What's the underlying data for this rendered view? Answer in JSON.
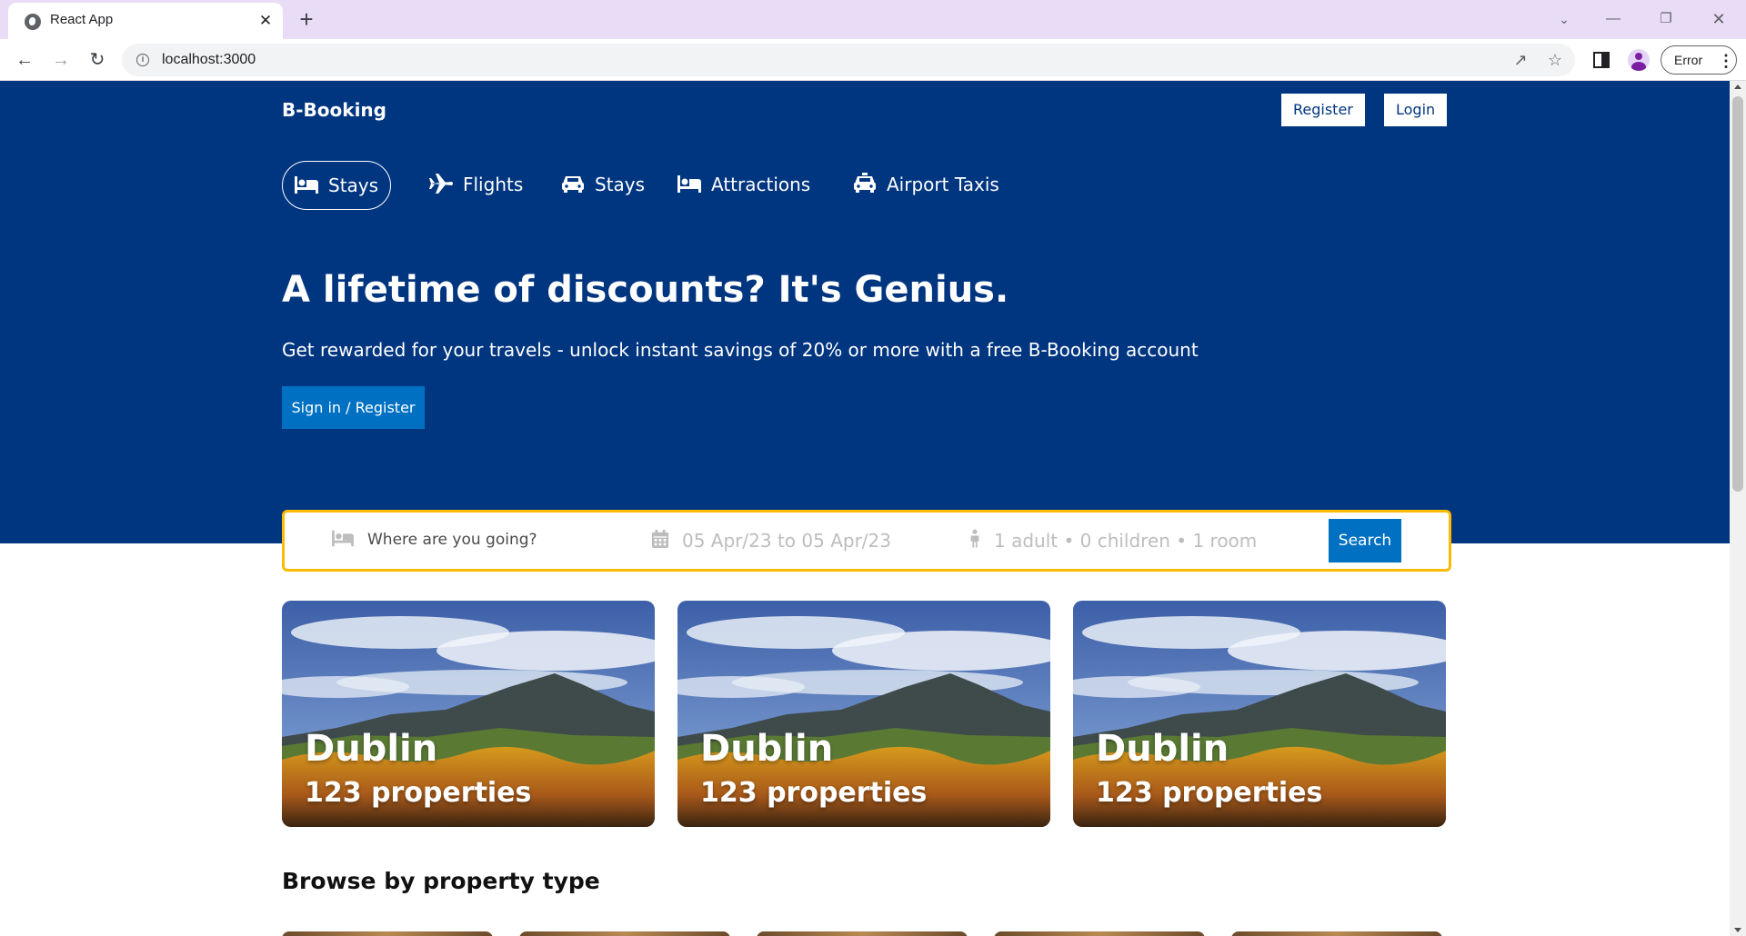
{
  "browser": {
    "tab_title": "React App",
    "tab_close": "✕",
    "new_tab": "+",
    "url": "localhost:3000",
    "profile_status": "Error"
  },
  "header": {
    "brand": "B-Booking",
    "register_label": "Register",
    "login_label": "Login"
  },
  "nav": {
    "items": [
      {
        "label": "Stays",
        "icon": "bed-icon",
        "active": true
      },
      {
        "label": "Flights",
        "icon": "plane-icon",
        "active": false
      },
      {
        "label": "Stays",
        "icon": "car-icon",
        "active": false
      },
      {
        "label": "Attractions",
        "icon": "bed-icon",
        "active": false
      },
      {
        "label": "Airport Taxis",
        "icon": "taxi-icon",
        "active": false
      }
    ]
  },
  "hero": {
    "title": "A lifetime of discounts? It's Genius.",
    "subtitle": "Get rewarded for your travels - unlock instant savings of 20% or more with a free B-Booking account",
    "cta_label": "Sign in / Register"
  },
  "search": {
    "destination_placeholder": "Where are you going?",
    "date_range": "05 Apr/23 to 05 Apr/23",
    "occupancy": "1 adult • 0 children • 1 room",
    "button_label": "Search"
  },
  "featured": [
    {
      "city": "Dublin",
      "properties": "123 properties"
    },
    {
      "city": "Dublin",
      "properties": "123 properties"
    },
    {
      "city": "Dublin",
      "properties": "123 properties"
    }
  ],
  "property_types": {
    "title": "Browse by property type"
  },
  "colors": {
    "brand_blue": "#003580",
    "button_blue": "#0071c2",
    "search_border": "#febb02",
    "tab_strip": "#e9dcf7"
  }
}
